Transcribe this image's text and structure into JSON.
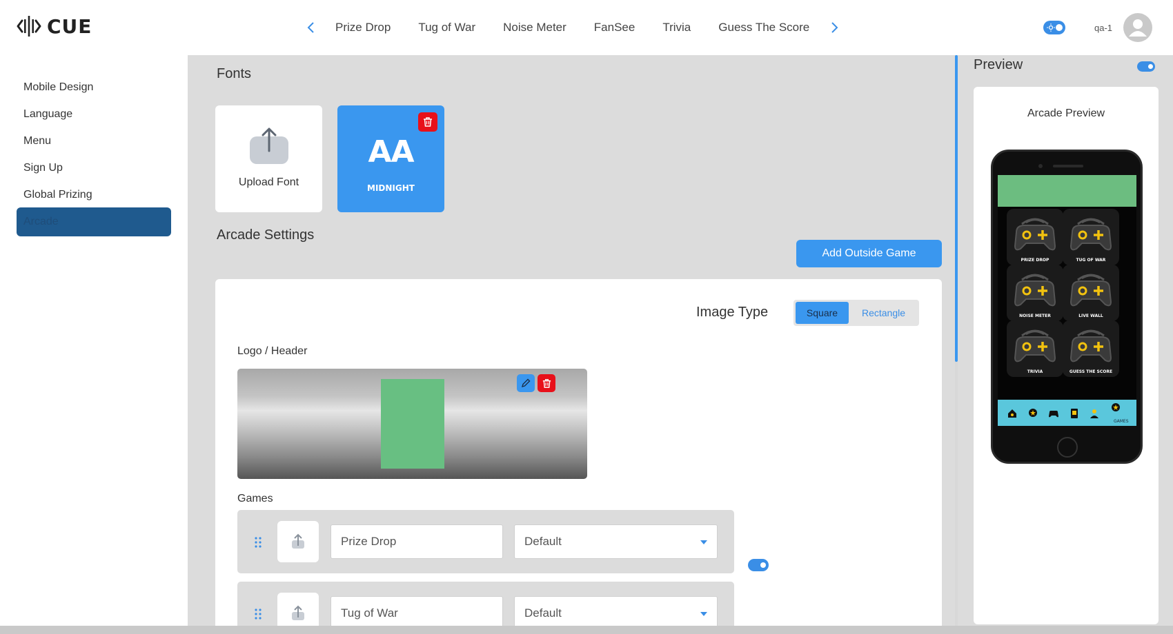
{
  "app": {
    "brand": "CUE"
  },
  "header": {
    "nav_tabs": [
      "Prize Drop",
      "Tug of War",
      "Noise Meter",
      "FanSee",
      "Trivia",
      "Guess The Score"
    ],
    "username": "qa-1"
  },
  "sidebar": {
    "items": [
      {
        "label": "Mobile Design"
      },
      {
        "label": "Language"
      },
      {
        "label": "Menu"
      },
      {
        "label": "Sign Up"
      },
      {
        "label": "Global Prizing"
      },
      {
        "label": "Arcade",
        "active": true
      }
    ]
  },
  "fonts": {
    "title": "Fonts",
    "upload_label": "Upload Font",
    "cards": [
      {
        "preview": "AA",
        "name": "MIDNIGHT"
      }
    ]
  },
  "arcade": {
    "title": "Arcade Settings",
    "add_button": "Add Outside Game",
    "image_type_label": "Image Type",
    "image_type_options": [
      "Square",
      "Rectangle"
    ],
    "image_type_selected": "Square",
    "logo_label": "Logo / Header",
    "games_label": "Games",
    "games": [
      {
        "name": "Prize Drop",
        "style": "Default",
        "enabled": true
      },
      {
        "name": "Tug of War",
        "style": "Default",
        "enabled": true
      }
    ]
  },
  "preview": {
    "title": "Preview",
    "enabled": true,
    "caption": "Arcade Preview",
    "tiles": [
      "PRIZE DROP",
      "TUG OF WAR",
      "NOISE METER",
      "LIVE WALL",
      "TRIVIA",
      "GUESS THE SCORE"
    ],
    "nav_active_label": "GAMES"
  },
  "colors": {
    "accent": "#3a97ef",
    "danger": "#e8101a",
    "sidebar_active": "#1f5a8e",
    "header_green": "#68bf82",
    "phone_nav": "#5ac7dc",
    "icon_gold": "#f2c20f"
  }
}
